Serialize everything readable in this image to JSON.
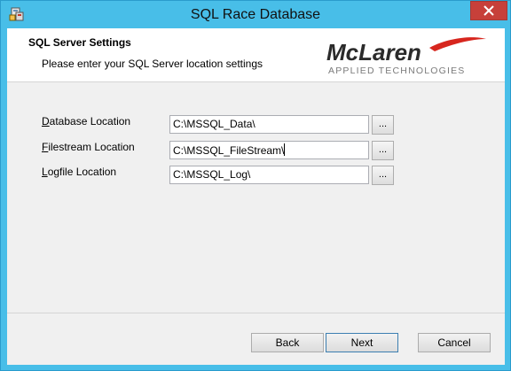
{
  "window": {
    "title": "SQL Race Database",
    "icon": "installer-icon",
    "close": "close-icon"
  },
  "header": {
    "title": "SQL Server Settings",
    "subtitle": "Please enter your SQL Server location settings",
    "logo_main": "McLaren",
    "logo_sub": "APPLIED TECHNOLOGIES"
  },
  "form": {
    "database": {
      "label": "Database Location",
      "value": "C:\\MSSQL_Data\\",
      "browse": "..."
    },
    "filestream": {
      "label": "Filestream Location",
      "value": "C:\\MSSQL_FileStream\\",
      "browse": "..."
    },
    "logfile": {
      "label": "Logfile Location",
      "value": "C:\\MSSQL_Log\\",
      "browse": "..."
    }
  },
  "buttons": {
    "back": "Back",
    "next": "Next",
    "cancel": "Cancel"
  },
  "colors": {
    "titlebar": "#48bee8",
    "close": "#c7403a",
    "logo_red": "#d7261e",
    "logo_dark": "#2b2b2b"
  }
}
